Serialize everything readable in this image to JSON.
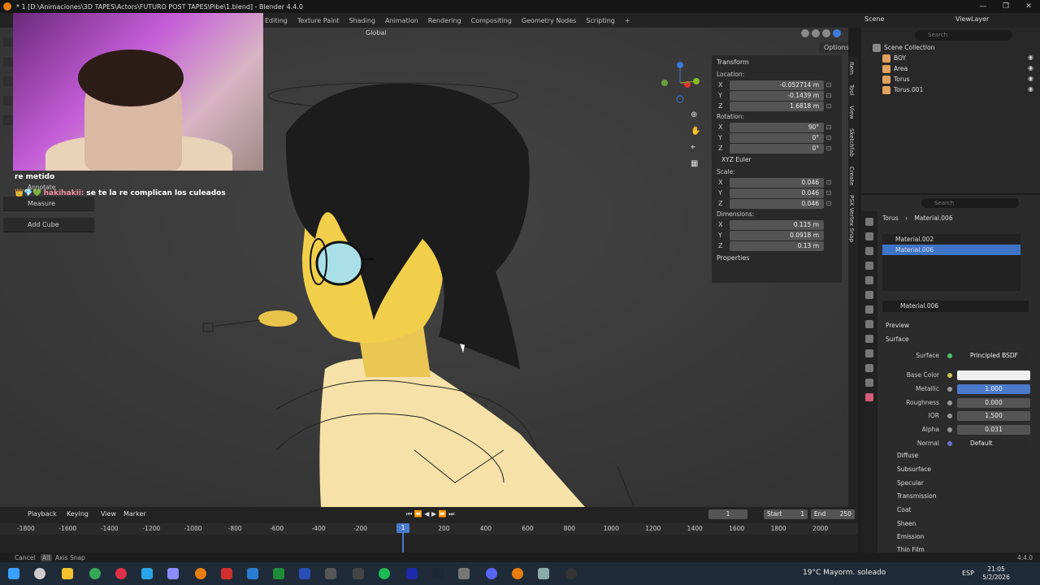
{
  "window": {
    "title": "* 1 [D:\\Animaciones\\3D TAPES\\Actors\\FUTURO POST TAPES\\Pibe\\1.blend] - Blender 4.4.0",
    "controls": [
      "—",
      "❐",
      "✕"
    ]
  },
  "workspaces": [
    "Editing",
    "Texture Paint",
    "Shading",
    "Animation",
    "Rendering",
    "Compositing",
    "Geometry Nodes",
    "Scripting",
    "+"
  ],
  "topright": {
    "scene": "Scene",
    "view_layer": "ViewLayer"
  },
  "viewport": {
    "orientation": "Global",
    "options": "Options",
    "cursor_note": ""
  },
  "chat": {
    "line1": "re metido",
    "user": "hakihakii:",
    "message": "se te la re complican los culeados",
    "badges": "👑💎💚"
  },
  "toolbox": {
    "annotate": "Annotate",
    "measure": "Measure",
    "add_cube": "Add Cube"
  },
  "npanel": {
    "header": "Transform",
    "location_label": "Location:",
    "location": {
      "x": "-0.052714 m",
      "y": "-0.1439 m",
      "z": "1.6818 m"
    },
    "rotation_label": "Rotation:",
    "rotation": {
      "x": "90°",
      "y": "0°",
      "z": "0°"
    },
    "rotation_mode": "XYZ Euler",
    "scale_label": "Scale:",
    "scale": {
      "x": "0.046",
      "y": "0.046",
      "z": "0.046"
    },
    "dimensions_label": "Dimensions:",
    "dimensions": {
      "x": "0.115 m",
      "y": "0.0918 m",
      "z": "0.13 m"
    },
    "properties": "Properties",
    "axis": {
      "x": "X",
      "y": "Y",
      "z": "Z"
    }
  },
  "sidetabs": [
    "Item",
    "Tool",
    "View",
    "Sketchfab",
    "Create",
    "PSX Vertex Snap"
  ],
  "outliner": {
    "search": "Search",
    "root": "Scene Collection",
    "items": [
      "BOY",
      "Area",
      "Torus",
      "Torus.001"
    ]
  },
  "properties": {
    "search": "Search",
    "object": "Torus",
    "material": "Material.006",
    "slots": [
      "Material.002",
      "Material.006"
    ],
    "mat_name": "Material.006",
    "preview": "Preview",
    "surface_section": "Surface",
    "surface_label": "Surface",
    "surface_value": "Principled BSDF",
    "rows": [
      {
        "label": "Base Color",
        "value": ""
      },
      {
        "label": "Metallic",
        "value": "1.000"
      },
      {
        "label": "Roughness",
        "value": "0.000"
      },
      {
        "label": "IOR",
        "value": "1.500"
      },
      {
        "label": "Alpha",
        "value": "0.031"
      },
      {
        "label": "Normal",
        "value": "Default"
      }
    ],
    "subsections": [
      "Diffuse",
      "Subsurface",
      "Specular",
      "Transmission",
      "Coat",
      "Sheen",
      "Emission",
      "Thin Film"
    ]
  },
  "timeline": {
    "menus": [
      "Playback",
      "Keying",
      "View",
      "Marker"
    ],
    "current_frame": "1",
    "cursor_frame": "1",
    "start_label": "Start",
    "start": "1",
    "end_label": "End",
    "end": "250",
    "ticks": [
      "-1800",
      "-1600",
      "-1400",
      "-1200",
      "-1000",
      "-800",
      "-600",
      "-400",
      "-200",
      "200",
      "400",
      "600",
      "800",
      "1000",
      "1200",
      "1400",
      "1600",
      "1800",
      "2000"
    ]
  },
  "statusbar": {
    "cancel": "Cancel",
    "alt": "Alt",
    "axis_snap": "Axis Snap",
    "version": "4.4.0"
  },
  "taskbar": {
    "weather": "19°C  Mayorm. soleado",
    "lang": "ESP",
    "time": "21:05",
    "date": "5/2/2026"
  }
}
